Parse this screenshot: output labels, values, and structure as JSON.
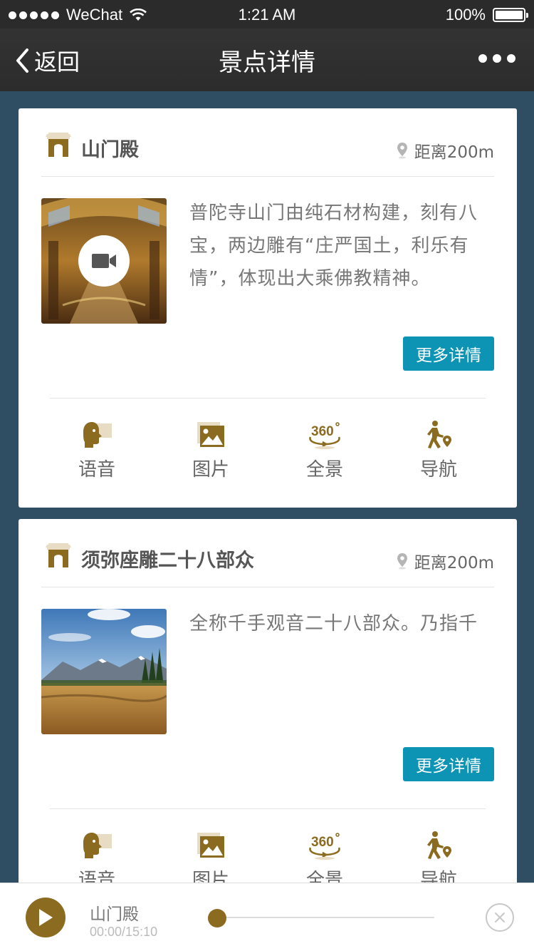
{
  "status_bar": {
    "carrier": "WeChat",
    "time": "1:21 AM",
    "battery": "100%",
    "battery_level": 1.0
  },
  "nav": {
    "back_label": "返回",
    "title": "景点详情"
  },
  "colors": {
    "accent_gold": "#8b6b1f",
    "button_blue": "#0d94b4",
    "page_bg": "#2f4d63"
  },
  "cards": [
    {
      "title": "山门殿",
      "distance": "距离200m",
      "description": "普陀寺山门由纯石材构建，刻有八宝，两边雕有“庄严国土，利乐有情”，体现出大乘佛教精神。",
      "has_video": true,
      "more_label": "更多详情",
      "actions": [
        {
          "label": "语音",
          "icon": "voice-icon"
        },
        {
          "label": "图片",
          "icon": "picture-icon"
        },
        {
          "label": "全景",
          "icon": "panorama-360-icon"
        },
        {
          "label": "导航",
          "icon": "navigation-walk-icon"
        }
      ]
    },
    {
      "title": "须弥座雕二十八部众",
      "distance": "距离200m",
      "description": "全称千手观音二十八部众。乃指千",
      "has_video": false,
      "more_label": "更多详情",
      "actions": [
        {
          "label": "语音",
          "icon": "voice-icon"
        },
        {
          "label": "图片",
          "icon": "picture-icon"
        },
        {
          "label": "全景",
          "icon": "panorama-360-icon"
        },
        {
          "label": "导航",
          "icon": "navigation-walk-icon"
        }
      ]
    }
  ],
  "player": {
    "title": "山门殿",
    "time": "00:00/15:10",
    "progress": 0.0
  }
}
